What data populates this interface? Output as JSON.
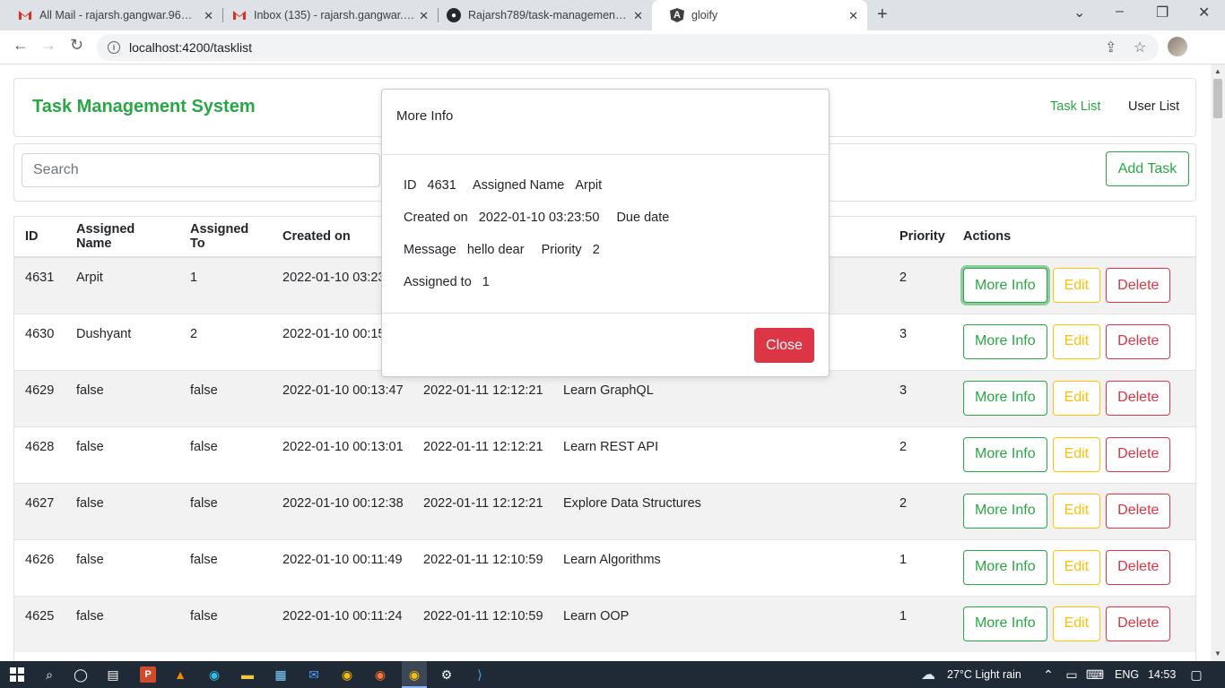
{
  "browser": {
    "tabs": [
      {
        "title": "All Mail - rajarsh.gangwar.96@gm",
        "icon": "gmail-icon"
      },
      {
        "title": "Inbox (135) - rajarsh.gangwar.97(",
        "icon": "gmail-icon"
      },
      {
        "title": "Rajarsh789/task-management-sy",
        "icon": "github-icon"
      },
      {
        "title": "gloify",
        "icon": "angular-icon"
      }
    ],
    "url": "localhost:4200/tasklist"
  },
  "app": {
    "brand": "Task Management System",
    "nav": {
      "task_list": "Task List",
      "user_list": "User List"
    },
    "search_placeholder": "Search",
    "add_task": "Add Task",
    "colors": {
      "brand": "#28a745",
      "edit": "#ffc107",
      "delete": "#dc3545"
    }
  },
  "table": {
    "headers": {
      "id": "ID",
      "name": "Assigned Name",
      "to": "Assigned To",
      "created": "Created on",
      "priority": "Priority",
      "actions": "Actions"
    },
    "actions": {
      "info": "More Info",
      "edit": "Edit",
      "delete": "Delete"
    },
    "rows": [
      {
        "id": "4631",
        "name": "Arpit",
        "to": "1",
        "created": "2022-01-10 03:23:50",
        "due": "",
        "message": "",
        "priority": "2"
      },
      {
        "id": "4630",
        "name": "Dushyant",
        "to": "2",
        "created": "2022-01-10 00:15:",
        "due": "",
        "message": "",
        "priority": "3"
      },
      {
        "id": "4629",
        "name": "false",
        "to": "false",
        "created": "2022-01-10 00:13:47",
        "due": "2022-01-11 12:12:21",
        "message": "Learn GraphQL",
        "priority": "3"
      },
      {
        "id": "4628",
        "name": "false",
        "to": "false",
        "created": "2022-01-10 00:13:01",
        "due": "2022-01-11 12:12:21",
        "message": "Learn REST API",
        "priority": "2"
      },
      {
        "id": "4627",
        "name": "false",
        "to": "false",
        "created": "2022-01-10 00:12:38",
        "due": "2022-01-11 12:12:21",
        "message": "Explore Data Structures",
        "priority": "2"
      },
      {
        "id": "4626",
        "name": "false",
        "to": "false",
        "created": "2022-01-10 00:11:49",
        "due": "2022-01-11 12:10:59",
        "message": "Learn Algorithms",
        "priority": "1"
      },
      {
        "id": "4625",
        "name": "false",
        "to": "false",
        "created": "2022-01-10 00:11:24",
        "due": "2022-01-11 12:10:59",
        "message": "Learn OOP",
        "priority": "1"
      }
    ]
  },
  "modal": {
    "title": "More Info",
    "id_label": "ID",
    "id_value": "4631",
    "name_label": "Assigned Name",
    "name_value": "Arpit",
    "created_label": "Created on",
    "created_value": "2022-01-10 03:23:50",
    "due_label": "Due date",
    "message_label": "Message",
    "message_value": "hello dear",
    "priority_label": "Priority",
    "priority_value": "2",
    "assigned_label": "Assigned to",
    "assigned_value": "1",
    "close": "Close"
  },
  "taskbar": {
    "weather": "27°C  Light rain",
    "lang": "ENG",
    "time": "14:53"
  }
}
